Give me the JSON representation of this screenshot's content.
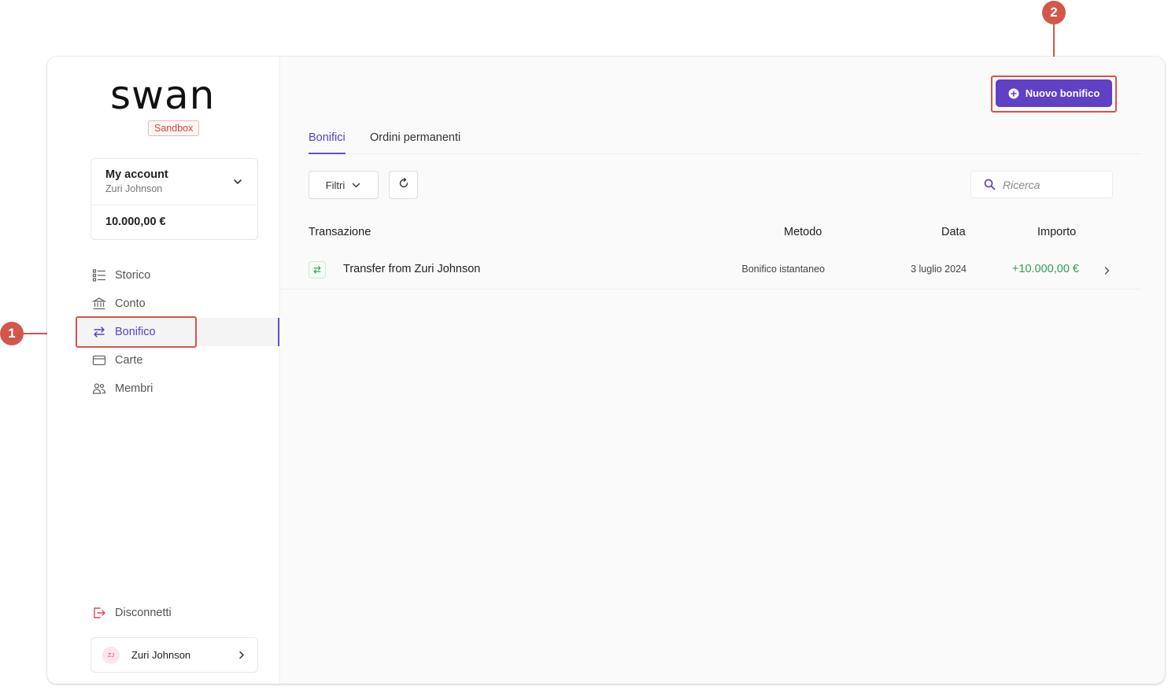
{
  "brand": {
    "logo_text": "swan",
    "env_badge": "Sandbox"
  },
  "account": {
    "name": "My account",
    "holder": "Zuri Johnson",
    "balance": "10.000,00 €"
  },
  "nav": {
    "items": [
      {
        "label": "Storico",
        "icon": "list-icon"
      },
      {
        "label": "Conto",
        "icon": "bank-icon"
      },
      {
        "label": "Bonifico",
        "icon": "transfer-icon",
        "active": true
      },
      {
        "label": "Carte",
        "icon": "card-icon"
      },
      {
        "label": "Membri",
        "icon": "members-icon"
      }
    ],
    "logout_label": "Disconnetti"
  },
  "user": {
    "initials": "ZJ",
    "name": "Zuri Johnson"
  },
  "toolbar": {
    "new_transfer_label": "Nuovo bonifico",
    "filter_label": "Filtri",
    "search_placeholder": "Ricerca"
  },
  "tabs": [
    {
      "label": "Bonifici",
      "active": true
    },
    {
      "label": "Ordini permanenti",
      "active": false
    }
  ],
  "table": {
    "columns": [
      "Transazione",
      "Metodo",
      "Data",
      "Importo"
    ],
    "rows": [
      {
        "title": "Transfer from Zuri Johnson",
        "method": "Bonifico istantaneo",
        "date": "3 luglio 2024",
        "amount": "+10.000,00 €"
      }
    ]
  },
  "callouts": [
    "1",
    "2"
  ],
  "colors": {
    "accent": "#6040c4",
    "positive": "#2f9c55",
    "callout": "#d2574a",
    "badge": "#d6483b"
  }
}
